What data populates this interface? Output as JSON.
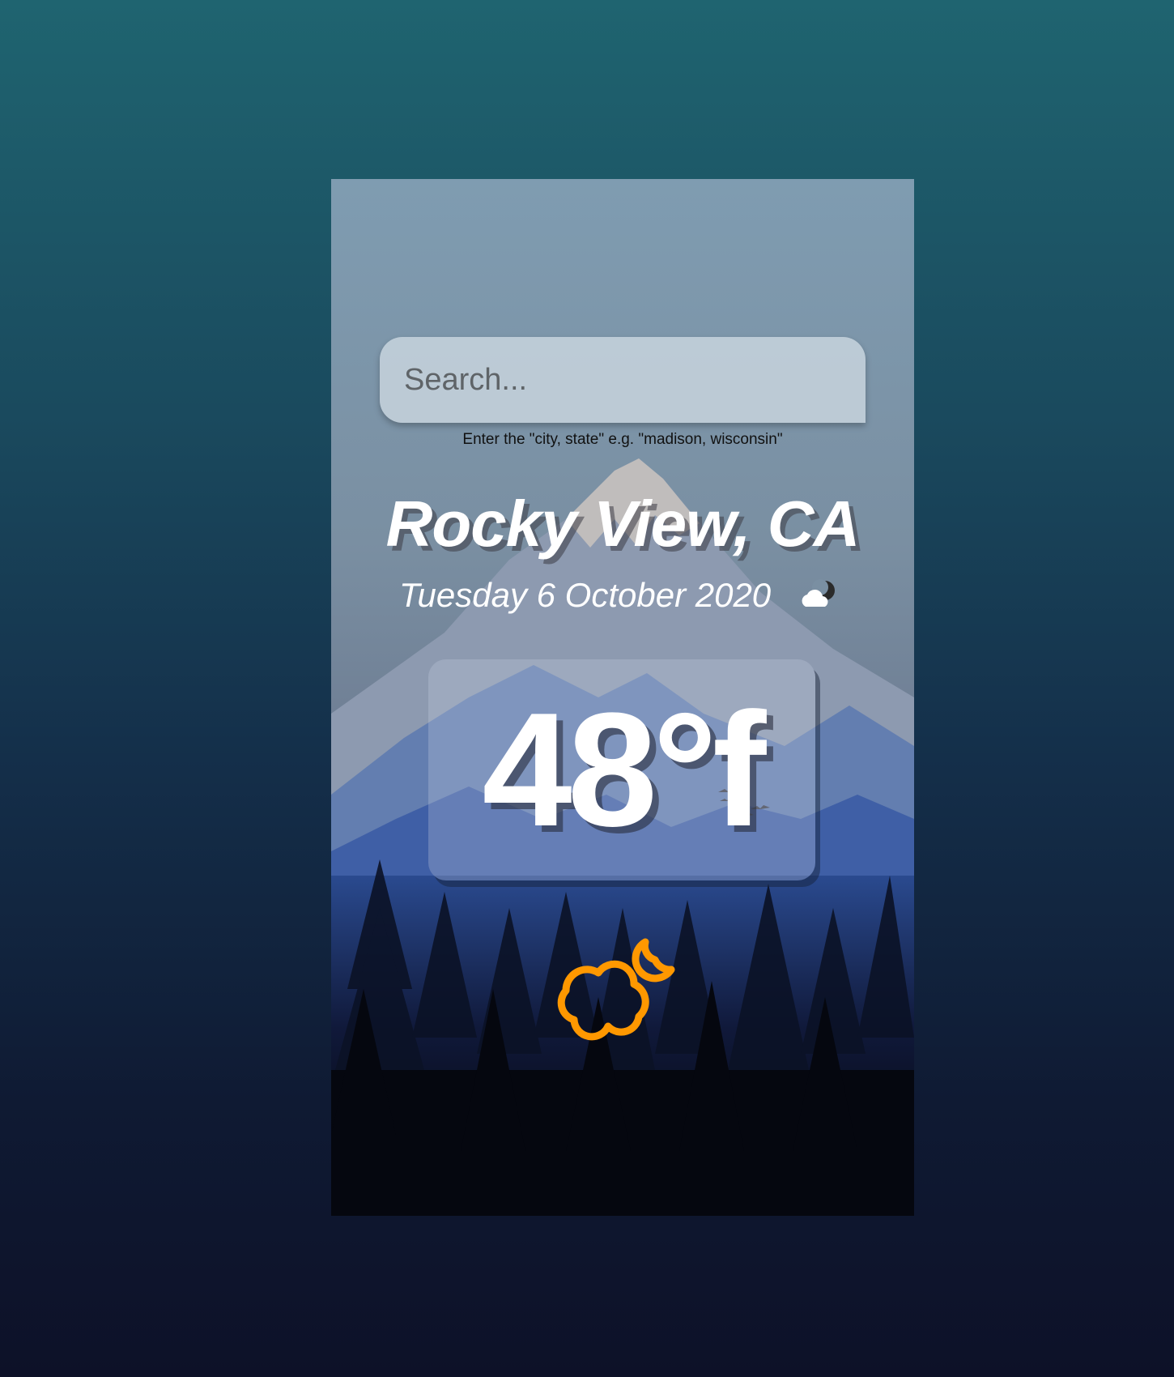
{
  "search": {
    "placeholder": "Search...",
    "value": "",
    "hint": "Enter the \"city, state\" e.g. \"madison, wisconsin\""
  },
  "weather": {
    "location": "Rocky View, CA",
    "date": "Tuesday 6 October 2020",
    "temperature": "48°f",
    "condition_icon": "partly-cloudy-night-icon",
    "condition_icon_large": "partly-cloudy-night-icon"
  },
  "colors": {
    "page_gradient_top": "#1f6470",
    "page_gradient_bottom": "#0d1128",
    "accent_icon": "#ff9800",
    "text": "#ffffff"
  }
}
